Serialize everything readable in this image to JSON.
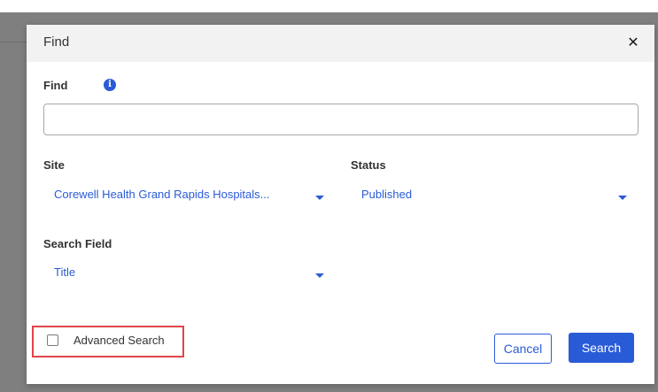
{
  "dialog": {
    "title": "Find",
    "close_icon": "close-icon"
  },
  "find": {
    "label": "Find",
    "info_icon": "info-icon",
    "value": "",
    "placeholder": ""
  },
  "site": {
    "label": "Site",
    "selected": "Corewell Health Grand Rapids Hospitals..."
  },
  "status": {
    "label": "Status",
    "selected": "Published"
  },
  "search_field": {
    "label": "Search Field",
    "selected": "Title"
  },
  "advanced_search": {
    "label": "Advanced Search",
    "checked": false
  },
  "buttons": {
    "cancel": "Cancel",
    "search": "Search"
  },
  "colors": {
    "accent": "#2a5bd7",
    "highlight": "#e0454a",
    "overlay": "#7f7f7f",
    "header_bg": "#f2f2f2"
  }
}
